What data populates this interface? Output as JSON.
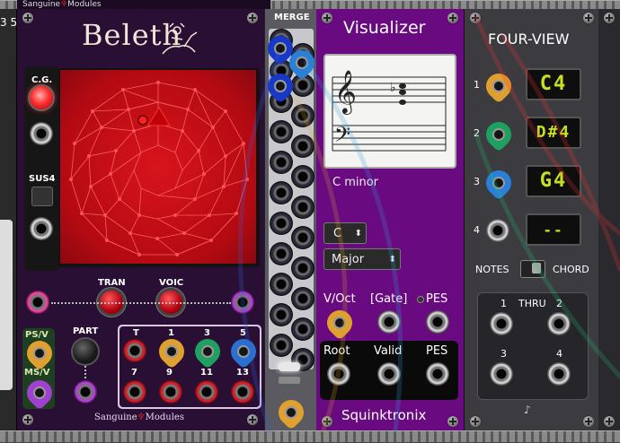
{
  "left_edge": {
    "number_text": "3 5"
  },
  "top_headers": {
    "left_brand": "Sanguine",
    "left_brand_suffix": "Modules"
  },
  "beleth": {
    "title": "Beleth",
    "cg_label": "C.G.",
    "sus4_label": "SUS4",
    "tran_label": "TRAN",
    "voic_label": "VOIC",
    "part_label": "PART",
    "psv_label": "PS/V",
    "msv_label": "MS/V",
    "row1_labels": [
      "T",
      "1",
      "3",
      "5"
    ],
    "row2_labels": [
      "7",
      "9",
      "11",
      "13"
    ],
    "footer_brand": "Sanguine",
    "footer_brand_suffix": "Modules",
    "accent_color": "#d0202a"
  },
  "merge": {
    "title": "MERGE"
  },
  "visualizer": {
    "title": "Visualizer",
    "chord_name": "C minor",
    "key_select": "C",
    "mode_select": "Major",
    "in_labels": [
      "V/Oct",
      "[Gate]",
      "PES"
    ],
    "out_labels": [
      "Root",
      "Valid",
      "PES"
    ],
    "brand": "Squinktronix",
    "flat_sign": "♭"
  },
  "four_view": {
    "title": "FOUR-VIEW",
    "rows": [
      {
        "num": "1",
        "display": "C4"
      },
      {
        "num": "2",
        "display": "D#4"
      },
      {
        "num": "3",
        "display": "G4"
      },
      {
        "num": "4",
        "display": "--"
      }
    ],
    "notes_label": "NOTES",
    "chord_label": "CHORD",
    "thru_label": "THRU",
    "thru_nums": [
      "1",
      "2",
      "3",
      "4"
    ]
  }
}
